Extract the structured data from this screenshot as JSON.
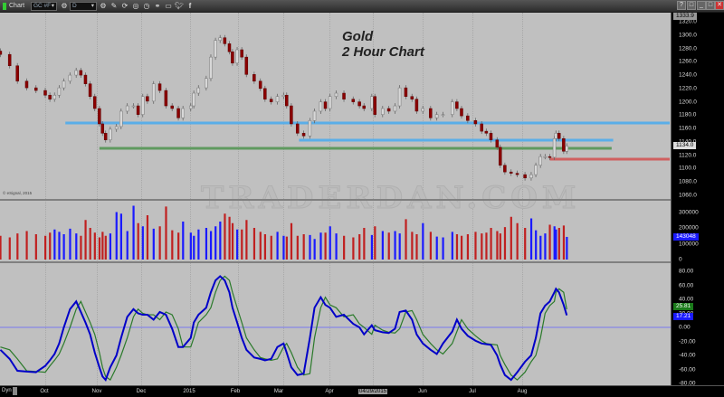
{
  "window": {
    "title": "Chart",
    "symbol": "GC #F",
    "interval": "D",
    "buttons": [
      "?",
      "□",
      "_",
      "□",
      "✕"
    ]
  },
  "toolbar_icons": [
    "settings-icon",
    "settings-icon",
    "pencil-icon",
    "refresh-icon",
    "target-icon",
    "clock-icon",
    "link-icon",
    "comment-icon",
    "twitter-icon",
    "facebook-icon"
  ],
  "chart_title": {
    "line1": "Gold",
    "line2": "2 Hour Chart"
  },
  "watermark": "TRADERDAN.COM",
  "copyright": "© eSignal, 2015",
  "colors": {
    "up_candle": "#d8d8d8",
    "down_candle": "#8b0000",
    "volume_up": "#1a1aff",
    "volume_down": "#c02020",
    "osc_main": "#0000c8",
    "osc_signal": "#2a7a2a",
    "zero_line": "#6060ff",
    "background": "#c0c0c0"
  },
  "chart_data": [
    {
      "type": "candlestick",
      "panel": "price",
      "ylim": [
        1053,
        1334
      ],
      "yticks": [
        "1320.0",
        "1300.0",
        "1280.0",
        "1260.0",
        "1240.0",
        "1220.0",
        "1200.0",
        "1180.0",
        "1160.0",
        "1140.0",
        "1120.0",
        "1100.0",
        "1080.0",
        "1060.0"
      ],
      "top_label": "1333.9",
      "last_price_label": "1134.0",
      "last_price": 1134.0,
      "dates": [
        "2014-09-02",
        "2014-09-08",
        "2014-09-13",
        "2014-09-19",
        "2014-09-25",
        "2014-10-01",
        "2014-10-04",
        "2014-10-07",
        "2014-10-10",
        "2014-10-13",
        "2014-10-17",
        "2014-10-21",
        "2014-10-24",
        "2014-10-27",
        "2014-10-30",
        "2014-11-02",
        "2014-11-05",
        "2014-11-07",
        "2014-11-09",
        "2014-11-12",
        "2014-11-16",
        "2014-11-19",
        "2014-11-23",
        "2014-11-27",
        "2014-11-30",
        "2014-12-03",
        "2014-12-06",
        "2014-12-10",
        "2014-12-14",
        "2014-12-18",
        "2014-12-22",
        "2014-12-26",
        "2014-12-29",
        "2015-01-03",
        "2015-01-05",
        "2015-01-08",
        "2015-01-13",
        "2015-01-16",
        "2015-01-19",
        "2015-01-22",
        "2015-01-25",
        "2015-01-28",
        "2015-01-30",
        "2015-02-02",
        "2015-02-05",
        "2015-02-08",
        "2015-02-13",
        "2015-02-17",
        "2015-02-20",
        "2015-02-24",
        "2015-02-28",
        "2015-03-04",
        "2015-03-06",
        "2015-03-09",
        "2015-03-13",
        "2015-03-17",
        "2015-03-21",
        "2015-03-24",
        "2015-03-28",
        "2015-03-31",
        "2015-04-03",
        "2015-04-07",
        "2015-04-12",
        "2015-04-18",
        "2015-04-22",
        "2015-04-25",
        "2015-04-30",
        "2015-05-02",
        "2015-05-07",
        "2015-05-11",
        "2015-05-15",
        "2015-05-18",
        "2015-05-22",
        "2015-05-26",
        "2015-05-29",
        "2015-06-02",
        "2015-06-07",
        "2015-06-11",
        "2015-06-15",
        "2015-06-21",
        "2015-06-24",
        "2015-06-27",
        "2015-07-01",
        "2015-07-06",
        "2015-07-10",
        "2015-07-13",
        "2015-07-16",
        "2015-07-20",
        "2015-07-22",
        "2015-07-25",
        "2015-07-29",
        "2015-08-02",
        "2015-08-07",
        "2015-08-11",
        "2015-08-14",
        "2015-08-17",
        "2015-08-20",
        "2015-08-23",
        "2015-08-26",
        "2015-08-27",
        "2015-08-29",
        "2015-09-01",
        "2015-09-03"
      ],
      "close": [
        1271,
        1254,
        1231,
        1221,
        1217,
        1210,
        1204,
        1210,
        1221,
        1231,
        1240,
        1247,
        1240,
        1227,
        1208,
        1190,
        1167,
        1153,
        1143,
        1159,
        1163,
        1186,
        1194,
        1194,
        1181,
        1208,
        1201,
        1227,
        1217,
        1194,
        1190,
        1176,
        1190,
        1194,
        1213,
        1221,
        1235,
        1267,
        1292,
        1296,
        1287,
        1275,
        1258,
        1278,
        1267,
        1241,
        1231,
        1220,
        1204,
        1200,
        1208,
        1210,
        1194,
        1167,
        1153,
        1149,
        1172,
        1186,
        1200,
        1190,
        1208,
        1213,
        1204,
        1200,
        1194,
        1190,
        1208,
        1181,
        1190,
        1186,
        1194,
        1221,
        1208,
        1204,
        1186,
        1190,
        1176,
        1181,
        1181,
        1200,
        1190,
        1179,
        1172,
        1167,
        1156,
        1153,
        1143,
        1132,
        1105,
        1095,
        1093,
        1091,
        1086,
        1091,
        1105,
        1118,
        1118,
        1117,
        1145,
        1153,
        1145,
        1126,
        1134
      ],
      "levels": [
        {
          "price": 1168.3,
          "color": "#5aaee8",
          "from": "2014-10-14",
          "to": "2015-11-17"
        },
        {
          "price": 1142.6,
          "color": "#5aaee8",
          "from": "2015-03-14",
          "to": "2015-10-03"
        },
        {
          "price": 1130.4,
          "color": "#5f9a5f",
          "from": "2014-11-05",
          "to": "2015-10-02"
        },
        {
          "price": 1114.2,
          "color": "#d06060",
          "from": "2015-08-23",
          "to": "2015-11-13"
        }
      ]
    },
    {
      "type": "bar",
      "panel": "volume",
      "ylim": [
        0,
        350000
      ],
      "yticks": [
        "300000",
        "200000",
        "100000",
        "0"
      ],
      "last_label": "143048",
      "values": [
        150000,
        140000,
        165000,
        180000,
        160000,
        150000,
        170000,
        190000,
        175000,
        160000,
        195000,
        165000,
        150000,
        250000,
        200000,
        170000,
        140000,
        175000,
        150000,
        165000,
        300000,
        290000,
        180000,
        340000,
        230000,
        210000,
        280000,
        195000,
        210000,
        335000,
        185000,
        170000,
        240000,
        170000,
        150000,
        190000,
        200000,
        180000,
        210000,
        240000,
        290000,
        270000,
        230000,
        190000,
        190000,
        250000,
        200000,
        175000,
        160000,
        150000,
        175000,
        150000,
        145000,
        230000,
        150000,
        160000,
        155000,
        130000,
        170000,
        170000,
        210000,
        165000,
        150000,
        140000,
        160000,
        200000,
        155000,
        210000,
        180000,
        170000,
        180000,
        165000,
        255000,
        175000,
        160000,
        230000,
        175000,
        145000,
        140000,
        175000,
        160000,
        150000,
        160000,
        175000,
        165000,
        170000,
        200000,
        180000,
        165000,
        205000,
        270000,
        230000,
        200000,
        260000,
        185000,
        150000,
        165000,
        220000,
        210000,
        190000,
        200000,
        215000,
        143048
      ]
    },
    {
      "type": "line",
      "panel": "oscillator",
      "ylim": [
        -80,
        90
      ],
      "yticks": [
        "80.00",
        "60.00",
        "40.00",
        "20.00",
        "0.00",
        "-20.00",
        "-40.00",
        "-60.00",
        "-80.00"
      ],
      "series": [
        {
          "label": "17.21",
          "color": "#0000c8",
          "values": [
            -32,
            -45,
            -62,
            -63,
            -64,
            -55,
            -47,
            -38,
            -23,
            0,
            26,
            37,
            22,
            7,
            -10,
            -36,
            -57,
            -70,
            -75,
            -57,
            -40,
            -15,
            15,
            26,
            20,
            18,
            18,
            11,
            22,
            18,
            -2,
            -28,
            -28,
            -15,
            7,
            18,
            28,
            50,
            67,
            73,
            67,
            50,
            28,
            7,
            -15,
            -32,
            -43,
            -45,
            -47,
            -45,
            -28,
            -23,
            -36,
            -57,
            -68,
            -66,
            -15,
            28,
            43,
            32,
            28,
            15,
            18,
            5,
            0,
            -10,
            3,
            -4,
            -7,
            -8,
            -2,
            22,
            24,
            11,
            -10,
            -23,
            -32,
            -38,
            -23,
            -6,
            11,
            -2,
            -12,
            -19,
            -23,
            -24,
            -25,
            -40,
            -53,
            -68,
            -75,
            -64,
            -49,
            -40,
            -15,
            20,
            31,
            37,
            50,
            55,
            50,
            32,
            17.21
          ]
        },
        {
          "label": "25.81",
          "color": "#2a7a2a",
          "values": [
            -28,
            -32,
            -45,
            -62,
            -63,
            -64,
            -55,
            -47,
            -38,
            -23,
            0,
            26,
            37,
            22,
            7,
            -10,
            -36,
            -57,
            -70,
            -75,
            -57,
            -40,
            -15,
            15,
            26,
            20,
            18,
            18,
            11,
            22,
            18,
            -2,
            -28,
            -28,
            -15,
            7,
            18,
            28,
            50,
            67,
            73,
            67,
            50,
            28,
            7,
            -15,
            -32,
            -43,
            -45,
            -47,
            -45,
            -28,
            -23,
            -36,
            -57,
            -68,
            -66,
            -15,
            28,
            43,
            32,
            28,
            15,
            18,
            5,
            0,
            -10,
            3,
            -4,
            -7,
            -8,
            -2,
            22,
            24,
            11,
            -10,
            -23,
            -32,
            -38,
            -23,
            -6,
            11,
            -2,
            -12,
            -19,
            -23,
            -24,
            -25,
            -40,
            -53,
            -68,
            -75,
            -64,
            -49,
            -40,
            -15,
            20,
            31,
            37,
            50,
            55,
            50,
            25.81
          ]
        }
      ]
    }
  ],
  "x_axis": {
    "mode_label": "Dyn",
    "labels": [
      "Oct",
      "Nov",
      "Dec",
      "2015",
      "Feb",
      "Mar",
      "Apr",
      "04/29/2015",
      "Jun",
      "Jul",
      "Aug"
    ]
  }
}
